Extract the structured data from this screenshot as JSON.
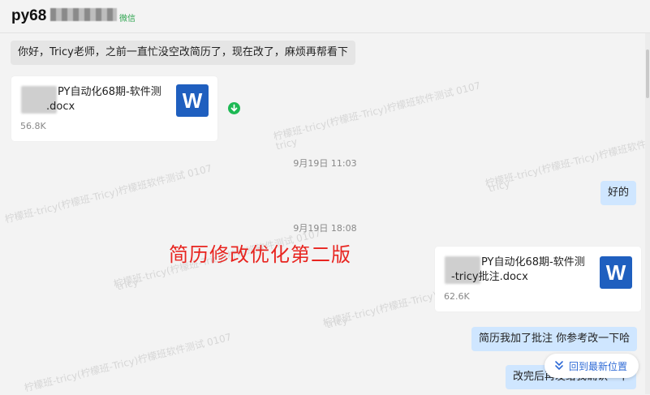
{
  "header": {
    "title": "py68",
    "channel_tag": "微信"
  },
  "messages": {
    "m1": "你好，Tricy老师，之前一直忙没空改简历了，现在改了，麻烦再帮看下",
    "file1": {
      "name_line1": "PY自动化68期-软件测",
      "name_line2": ".docx",
      "size": "56.8K",
      "icon_letter": "W"
    },
    "ts1": "9月19日 11:03",
    "m2": "好的",
    "ts2": "9月19日 18:08",
    "file2": {
      "name_line1": "PY自动化68期-软件测",
      "name_line2": "-tricy批注.docx",
      "size": "62.6K",
      "icon_letter": "W"
    },
    "m3": "简历我加了批注 你参考改一下哈",
    "m4": "改完后再发给我确认一下"
  },
  "annotation": "简历修改优化第二版",
  "jump_button": "回到最新位置",
  "watermarks": [
    "柠檬班-tricy(柠檬班-Tricy)柠檬班软件测试 0107",
    "tricy"
  ],
  "colors": {
    "accent_blue": "#2f6bd6",
    "annotation_red": "#e8241f",
    "word_blue": "#1f5fbf",
    "wechat_green": "#2ea44f",
    "download_green": "#1db954"
  }
}
